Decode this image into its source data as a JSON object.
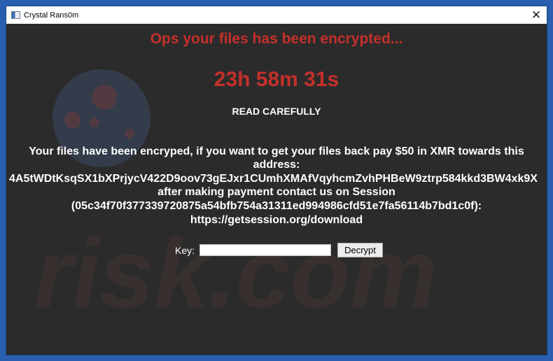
{
  "window": {
    "title": "Crystal Rans0m",
    "close_glyph": "✕"
  },
  "message": {
    "headline": "Ops your files has been encrypted...",
    "countdown": "23h 58m 31s",
    "read_carefully": "READ CAREFULLY",
    "lines": [
      "Your files have been encryped, if you want to get your files back pay $50 in XMR towards this",
      "address:",
      "4A5tWDtKsqSX1bXPrjycV422D9oov73gEJxr1CUmhXMAfVqyhcmZvhPHBeW9ztrp584kkd3BW4xk9X",
      "after making payment contact us on Session",
      "(05c34f70f377339720875a54bfb754a31311ed994986cfd51e7fa56114b7bd1c0f):",
      "https://getsession.org/download"
    ]
  },
  "form": {
    "key_label": "Key:",
    "key_value": "",
    "key_placeholder": "",
    "decrypt_label": "Decrypt"
  },
  "watermark": {
    "text": "risk.com"
  },
  "colors": {
    "accent_red": "#c4302b",
    "background": "#2b2b2b",
    "text": "#ffffff",
    "desktop": "#2a5fb0"
  }
}
